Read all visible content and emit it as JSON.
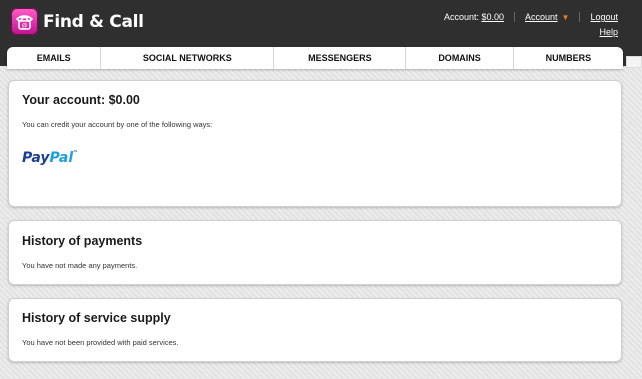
{
  "app": {
    "name": "Find & Call"
  },
  "header": {
    "account_balance_label": "Account:",
    "account_balance_value": "$0.00",
    "account_menu_label": "Account",
    "logout_label": "Logout",
    "help_label": "Help"
  },
  "nav": {
    "tabs": [
      {
        "label": "EMAILS"
      },
      {
        "label": "SOCIAL NETWORKS"
      },
      {
        "label": "MESSENGERS"
      },
      {
        "label": "DOMAINS"
      },
      {
        "label": "NUMBERS"
      }
    ]
  },
  "account_panel": {
    "title": "Your account: $0.00",
    "text": "You can credit your account by one of the following ways:",
    "payment_methods": [
      {
        "name": "PayPal",
        "brand_part1": "Pay",
        "brand_part2": "Pal"
      }
    ]
  },
  "payments_panel": {
    "title": "History of payments",
    "text": "You have not made any payments."
  },
  "supply_panel": {
    "title": "History of service supply",
    "text": "You have not been provided with paid services."
  },
  "colors": {
    "header_bg": "#2f2f2f",
    "logo_pink": "#e8209f",
    "paypal_dark": "#1b3f95",
    "paypal_light": "#1c9fdd",
    "caret_orange": "#f47b20"
  }
}
